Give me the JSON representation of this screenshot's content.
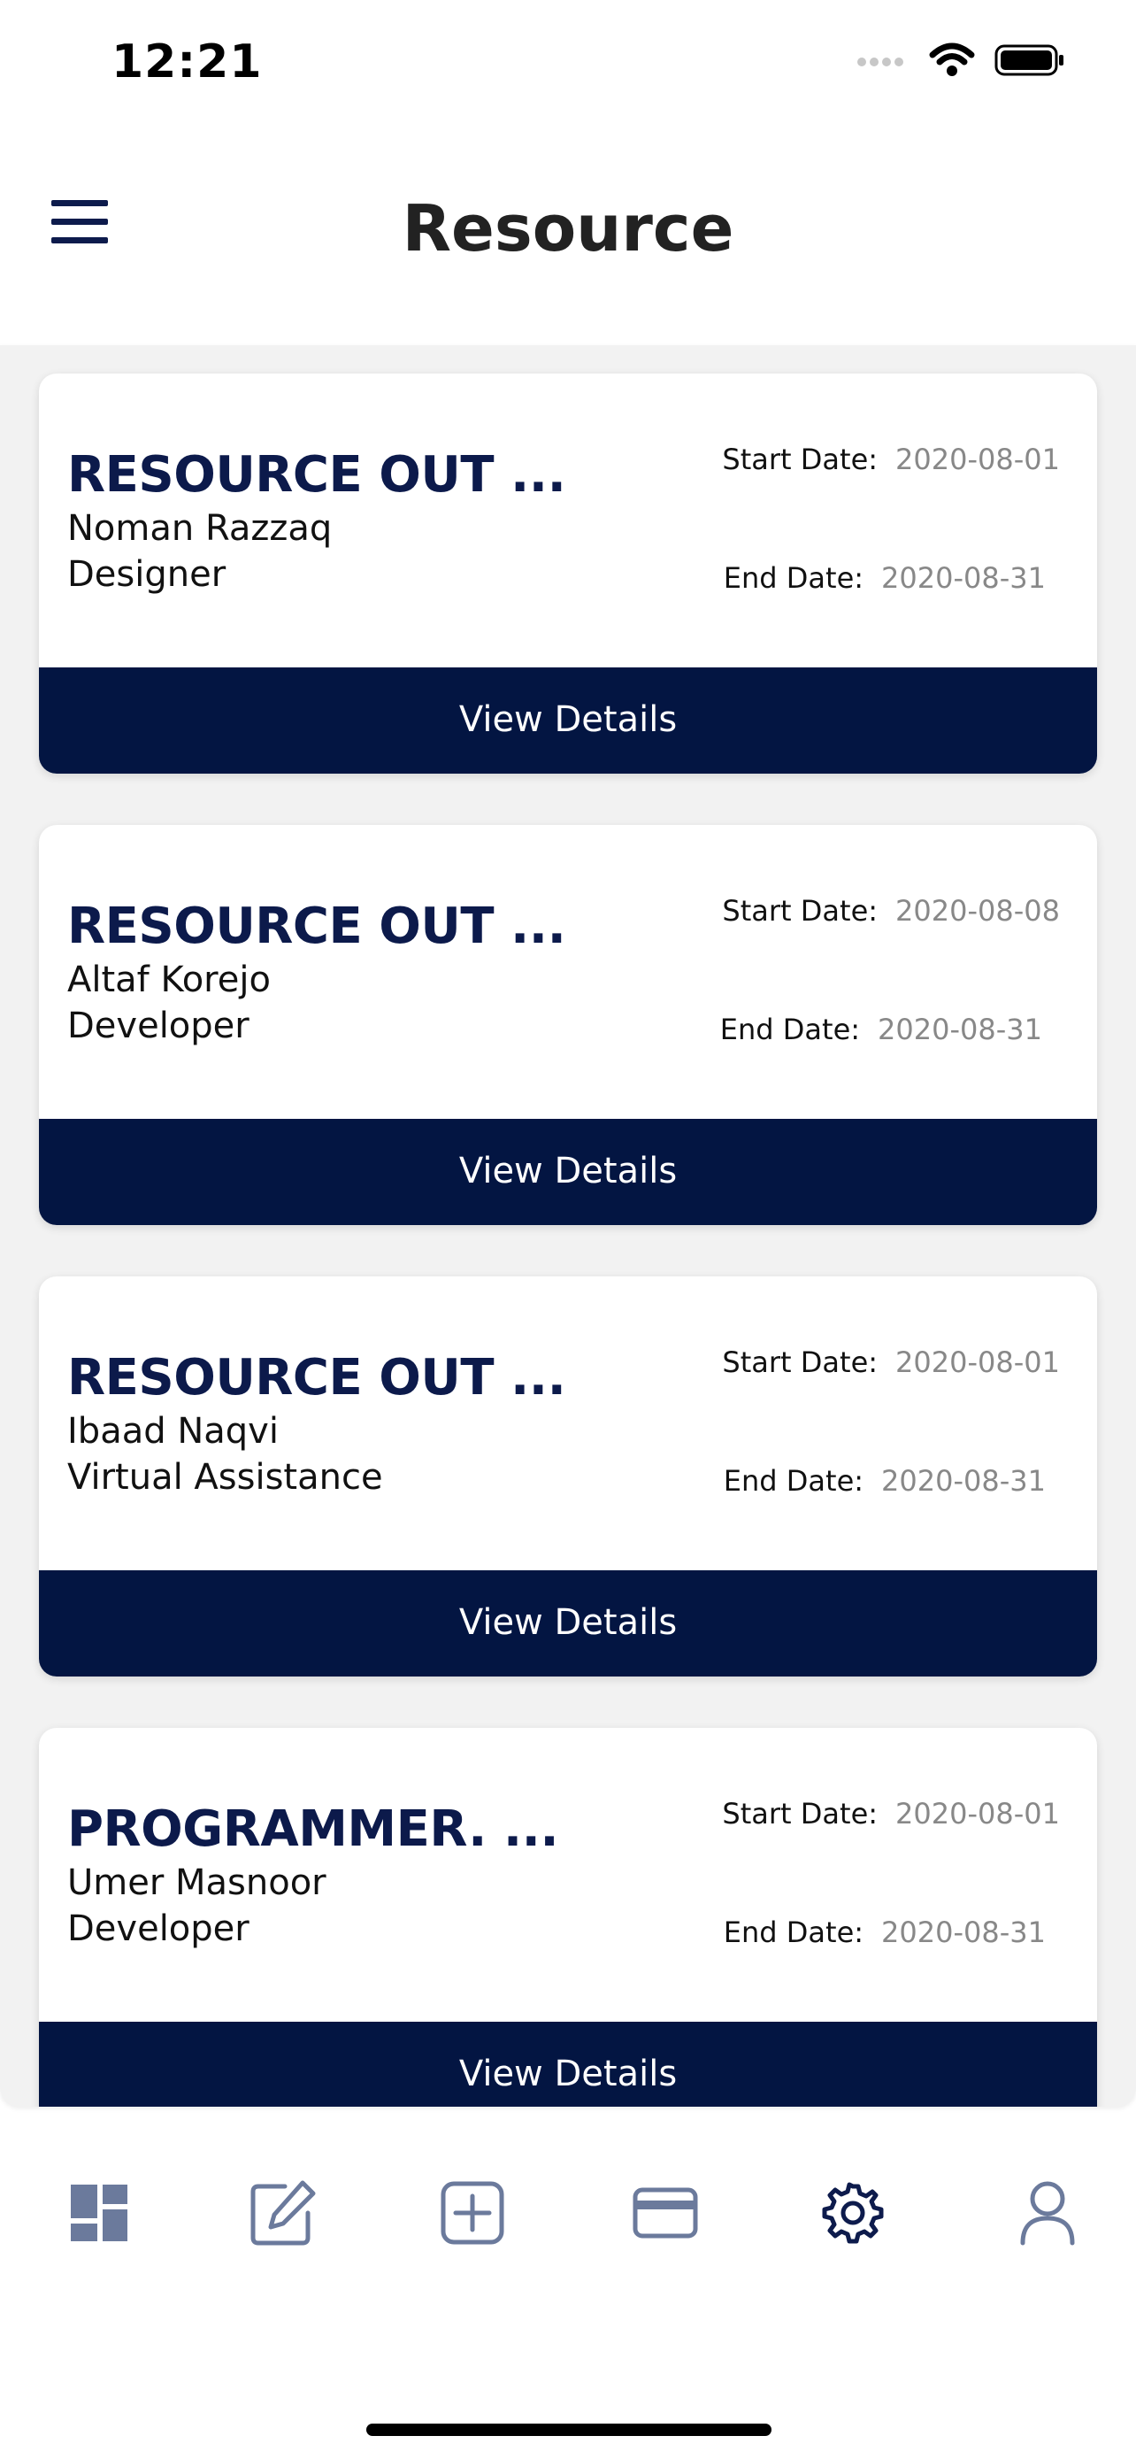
{
  "status_bar": {
    "time": "12:21"
  },
  "header": {
    "title": "Resource"
  },
  "cards": [
    {
      "title": "RESOURCE OUT ...",
      "name": "Noman Razzaq",
      "role": "Designer",
      "start_label": "Start Date:",
      "start_date": "2020-08-01",
      "end_label": "End Date:",
      "end_date": "2020-08-31",
      "button": "View Details"
    },
    {
      "title": "RESOURCE OUT ...",
      "name": "Altaf Korejo",
      "role": "Developer",
      "start_label": "Start Date:",
      "start_date": "2020-08-08",
      "end_label": "End Date:",
      "end_date": "2020-08-31",
      "button": "View Details"
    },
    {
      "title": "RESOURCE OUT ...",
      "name": "Ibaad Naqvi",
      "role": "Virtual Assistance",
      "start_label": "Start Date:",
      "start_date": "2020-08-01",
      "end_label": "End Date:",
      "end_date": "2020-08-31",
      "button": "View Details"
    },
    {
      "title": "PROGRAMMER.  ...",
      "name": "Umer Masnoor",
      "role": "Developer",
      "start_label": "Start Date:",
      "start_date": "2020-08-01",
      "end_label": "End Date:",
      "end_date": "2020-08-31",
      "button": "View Details"
    }
  ],
  "tab_bar": {
    "items": [
      {
        "icon": "dashboard-icon"
      },
      {
        "icon": "edit-icon"
      },
      {
        "icon": "add-icon"
      },
      {
        "icon": "card-icon"
      },
      {
        "icon": "gear-icon",
        "active": true
      },
      {
        "icon": "user-icon"
      }
    ]
  },
  "colors": {
    "primary": "#031542",
    "title": "#0c1a4b",
    "inactive_icon": "#6b7a9c",
    "active_icon": "#0d1b4c"
  }
}
